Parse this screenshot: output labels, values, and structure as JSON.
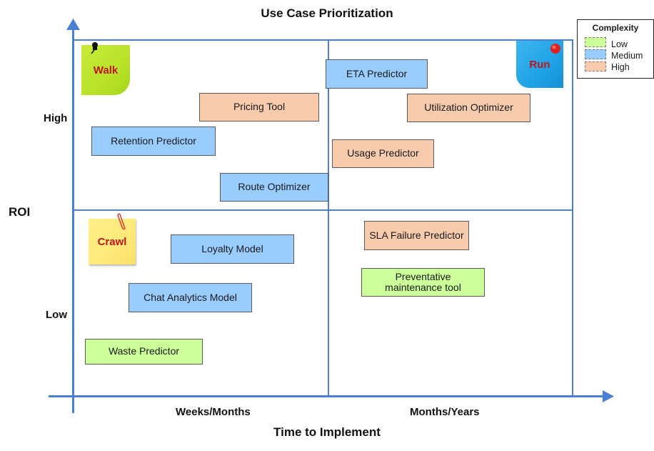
{
  "title": "Use Case Prioritization",
  "axes": {
    "y_title": "ROI",
    "y_high": "High",
    "y_low": "Low",
    "x_title": "Time to Implement",
    "x_left": "Weeks/Months",
    "x_right": "Months/Years"
  },
  "legend": {
    "title": "Complexity",
    "items": [
      {
        "label": "Low",
        "color": "#ccff99"
      },
      {
        "label": "Medium",
        "color": "#99ccff"
      },
      {
        "label": "High",
        "color": "#f8cbad"
      }
    ]
  },
  "quadrants": {
    "walk": "Walk",
    "run": "Run",
    "crawl": "Crawl"
  },
  "use_cases": [
    {
      "label": "ETA Predictor",
      "complexity": "Medium",
      "quadrant": "Run"
    },
    {
      "label": "Pricing Tool",
      "complexity": "High",
      "quadrant": "Walk"
    },
    {
      "label": "Utilization Optimizer",
      "complexity": "High",
      "quadrant": "Run"
    },
    {
      "label": "Retention Predictor",
      "complexity": "Medium",
      "quadrant": "Walk"
    },
    {
      "label": "Usage Predictor",
      "complexity": "High",
      "quadrant": "Run"
    },
    {
      "label": "Route Optimizer",
      "complexity": "Medium",
      "quadrant": "Walk"
    },
    {
      "label": "SLA Failure Predictor",
      "complexity": "High",
      "quadrant": "Low ROI / Months-Years"
    },
    {
      "label": "Loyalty Model",
      "complexity": "Medium",
      "quadrant": "Crawl"
    },
    {
      "label": "Preventative maintenance tool",
      "complexity": "Low",
      "quadrant": "Low ROI / Months-Years"
    },
    {
      "label": "Chat Analytics Model",
      "complexity": "Medium",
      "quadrant": "Crawl"
    },
    {
      "label": "Waste Predictor",
      "complexity": "Low",
      "quadrant": "Crawl"
    }
  ],
  "colors": {
    "axis": "#4a7fd4",
    "low": "#ccff99",
    "medium": "#99ccff",
    "high": "#f8cbad"
  }
}
